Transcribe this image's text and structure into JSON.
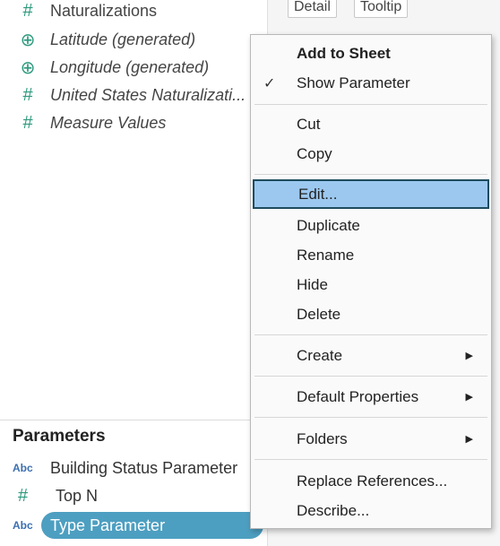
{
  "shelf": {
    "detail_label": "Detail",
    "tooltip_label": "Tooltip"
  },
  "fields": [
    {
      "icon": "#",
      "icon_name": "measure-hash-icon",
      "label": "Naturalizations"
    },
    {
      "icon": "⊕",
      "icon_name": "globe-icon",
      "label": "Latitude (generated)"
    },
    {
      "icon": "⊕",
      "icon_name": "globe-icon",
      "label": "Longitude (generated)"
    },
    {
      "icon": "#",
      "icon_name": "measure-hash-icon",
      "label": "United States Naturalizati..."
    },
    {
      "icon": "#",
      "icon_name": "measure-hash-icon",
      "label": "Measure Values"
    }
  ],
  "parameters": {
    "header": "Parameters",
    "items": [
      {
        "icon": "Abc",
        "icon_name": "string-type-icon",
        "label": "Building Status Parameter"
      },
      {
        "icon": "#",
        "icon_name": "number-type-icon",
        "label": "Top N"
      },
      {
        "icon": "Abc",
        "icon_name": "string-type-icon",
        "label": "Type Parameter",
        "selected": true
      }
    ]
  },
  "context_menu": {
    "items": [
      {
        "label": "Add to Sheet",
        "bold": true
      },
      {
        "label": "Show Parameter",
        "checked": true,
        "check_glyph": "✓"
      },
      {
        "label": "Cut"
      },
      {
        "label": "Copy"
      },
      {
        "label": "Edit...",
        "highlighted": true
      },
      {
        "label": "Duplicate"
      },
      {
        "label": "Rename"
      },
      {
        "label": "Hide"
      },
      {
        "label": "Delete"
      },
      {
        "label": "Create",
        "submenu": true,
        "arrow": "▶"
      },
      {
        "label": "Default Properties",
        "submenu": true,
        "arrow": "▶"
      },
      {
        "label": "Folders",
        "submenu": true,
        "arrow": "▶"
      },
      {
        "label": "Replace References..."
      },
      {
        "label": "Describe..."
      }
    ]
  },
  "colors": {
    "highlight": "#9cc8ef",
    "highlight_border": "#1e4b5e",
    "selected_pill": "#4d9fc1",
    "field_icon": "#2e9a7e"
  }
}
